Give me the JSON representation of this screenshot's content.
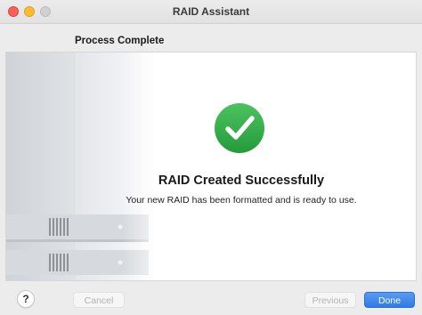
{
  "window": {
    "title": "RAID Assistant"
  },
  "step": {
    "label": "Process Complete"
  },
  "result": {
    "title": "RAID Created Successfully",
    "message": "Your new RAID has been formatted and is ready to use.",
    "status_icon": "checkmark-circle-icon",
    "status_color": "#2fa94a"
  },
  "footer": {
    "help_label": "?",
    "cancel_label": "Cancel",
    "previous_label": "Previous",
    "done_label": "Done"
  },
  "colors": {
    "accent": "#2f7be6",
    "close": "#ff5f57",
    "minimize": "#febc2e"
  }
}
